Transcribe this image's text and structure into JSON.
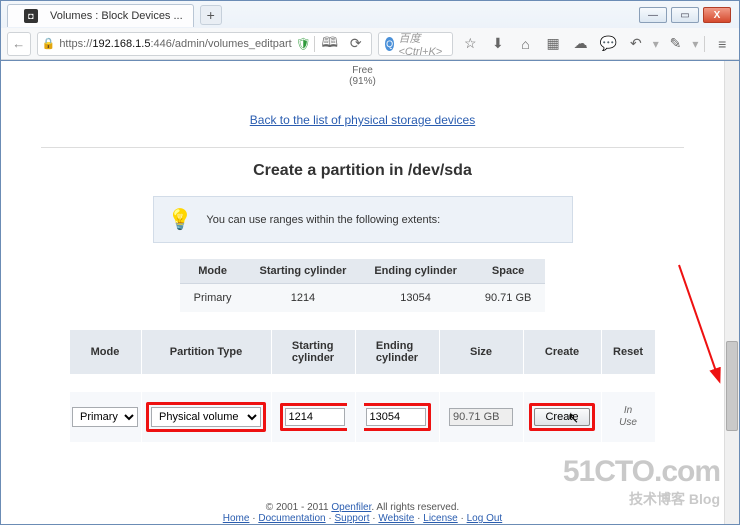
{
  "window": {
    "tab_title": "Volumes : Block Devices ...",
    "win_min": "—",
    "win_max": "▭",
    "win_close": "X"
  },
  "toolbar": {
    "back": "←",
    "url_prefix": "https://",
    "url_host": "192.168.1.5",
    "url_path": ":446/admin/volumes_editpart",
    "shield": "🛡",
    "book": "🕮",
    "reload": "⟳",
    "search_placeholder": "百度 <Ctrl+K>",
    "icons": {
      "star": "☆",
      "down": "⬇",
      "home": "⌂",
      "four": "▦",
      "cloud": "☁",
      "chat": "💬",
      "undo": "↶",
      "tool": "✎",
      "menu": "≡"
    }
  },
  "page": {
    "free_label": "Free",
    "free_pct": "(91%)",
    "back_link": "Back to the list of physical storage devices",
    "heading": "Create a partition in /dev/sda",
    "info_text": "You can use ranges within the following extents:",
    "extent": {
      "headers": {
        "mode": "Mode",
        "start": "Starting cylinder",
        "end": "Ending cylinder",
        "space": "Space"
      },
      "row": {
        "mode": "Primary",
        "start": "1214",
        "end": "13054",
        "space": "90.71 GB"
      }
    },
    "form": {
      "headers": {
        "mode": "Mode",
        "ptype": "Partition Type",
        "start": "Starting\ncylinder",
        "end": "Ending\ncylinder",
        "size": "Size",
        "create": "Create",
        "reset": "Reset"
      },
      "mode_selected": "Primary",
      "ptype_selected": "Physical volume",
      "start_val": "1214",
      "end_val": "13054",
      "size_val": "90.71 GB",
      "create_btn": "Create",
      "in_use": "In\nUse"
    },
    "footer": {
      "copyright": "© 2001 - 2011 ",
      "openfiler": "Openfiler",
      "rights": ". All rights reserved.",
      "links": {
        "home": "Home",
        "docs": "Documentation",
        "support": "Support",
        "website": "Website",
        "license": "License",
        "logout": "Log Out"
      }
    }
  },
  "watermark": {
    "big": "51CTO.com",
    "small": "技术博客  Blog"
  }
}
